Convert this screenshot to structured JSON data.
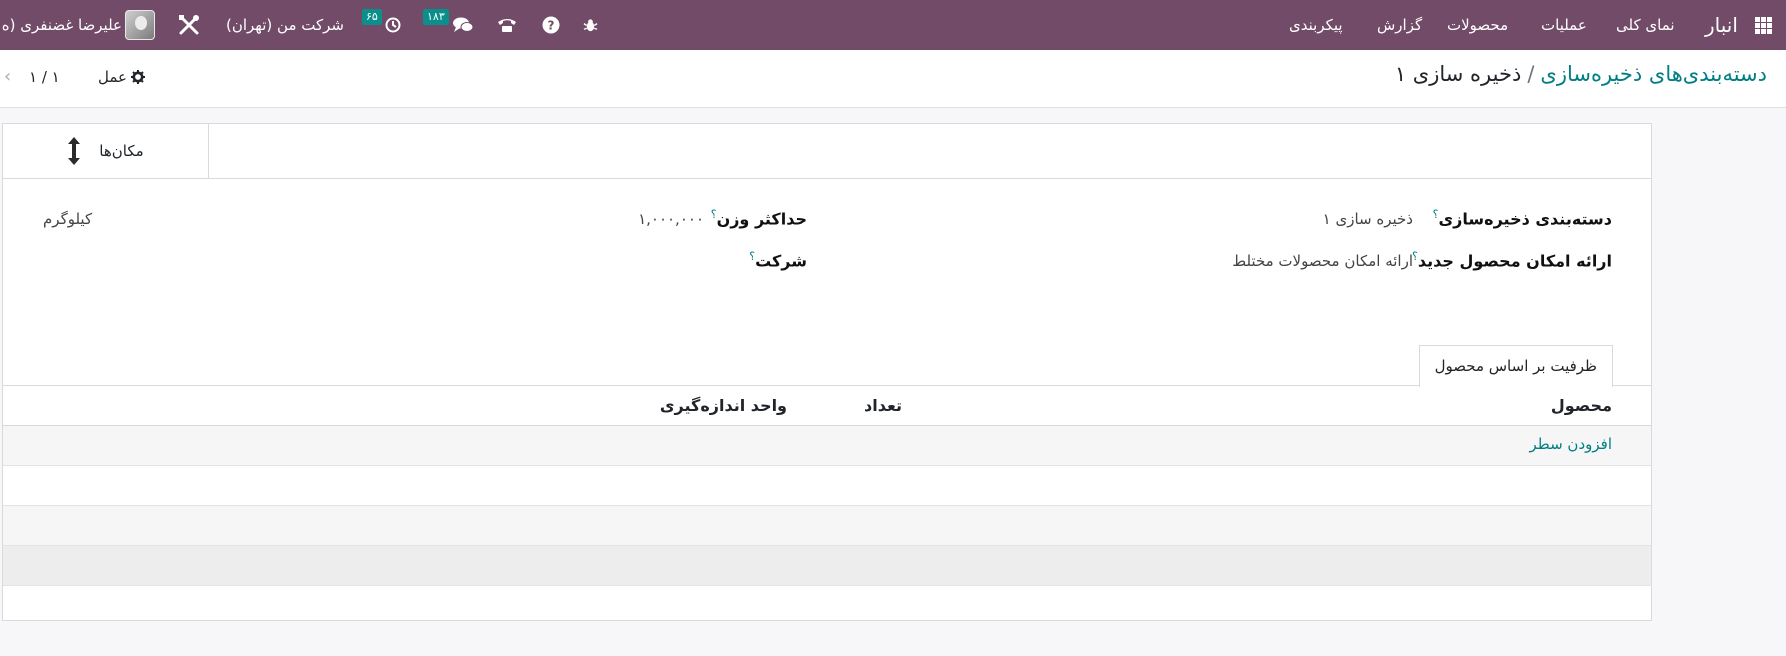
{
  "navbar": {
    "app_name": "انبار",
    "menu": [
      "نمای کلی",
      "عملیات",
      "محصولات",
      "گزارش",
      "پیکربندی"
    ],
    "messages_count": "۱۸۳",
    "activities_count": "۶۵",
    "company": "شرکت من (تهران)",
    "user_name": "علیرضا غضنفری (ه",
    "icons": [
      "apps-icon",
      "bug-icon",
      "help-icon",
      "phone-icon",
      "chat-icon",
      "clock-icon",
      "tools-icon"
    ],
    "bg_color": "#714b67"
  },
  "breadcrumb": {
    "parent": "دسته‌بندی‌های ذخیره‌سازی",
    "separator": "/",
    "current": "ذخیره سازی ۱"
  },
  "toolbar": {
    "action_label": "عمل",
    "pager": "۱ / ۱"
  },
  "smart_button": {
    "label": "مکان‌ها",
    "icon": "arrows-vertical-icon"
  },
  "fields": {
    "storage_category_label": "دسته‌بندی ذخیره‌سازی",
    "storage_category_value": "ذخیره سازی ۱",
    "allow_new_product_label": "ارائه امکان محصول جدید",
    "allow_new_product_value": "ارائه امکان محصولات مختلط",
    "max_weight_label": "حداکثر وزن",
    "max_weight_value": "۱,۰۰۰,۰۰۰",
    "max_weight_unit": "کیلوگرم",
    "company_label": "شرکت",
    "help_mark": "؟"
  },
  "tabs": [
    {
      "label": "ظرفیت بر اساس محصول",
      "active": true
    }
  ],
  "table": {
    "columns": [
      "محصول",
      "تعداد",
      "واحد اندازه‌گیری"
    ],
    "add_line": "افزودن سطر"
  },
  "colors": {
    "accent": "#017e84",
    "badge": "#0a8f8a"
  }
}
